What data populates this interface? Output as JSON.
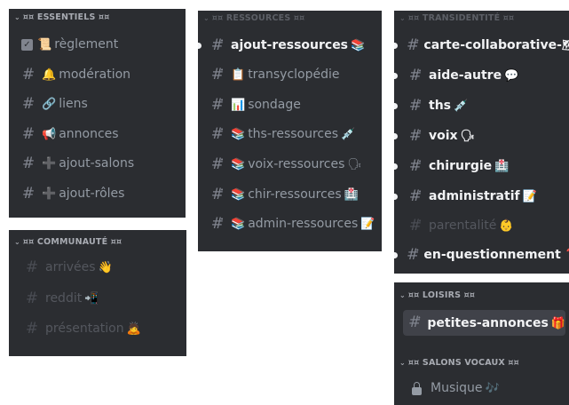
{
  "panels": {
    "essentiels": {
      "title": "¤¤ ESSENTIELS ¤¤",
      "channels": [
        {
          "label": "règlement",
          "emoji": "📜"
        },
        {
          "label": "modération",
          "emoji": "🔔"
        },
        {
          "label": "liens",
          "emoji": "🔗"
        },
        {
          "label": "annonces",
          "emoji": "📢"
        },
        {
          "label": "ajout-salons",
          "emoji": "➕"
        },
        {
          "label": "ajout-rôles",
          "emoji": "➕"
        }
      ]
    },
    "communaute": {
      "title": "¤¤ COMMUNAUTÉ ¤¤",
      "channels": [
        {
          "label": "arrivées",
          "emoji": "👋"
        },
        {
          "label": "reddit",
          "emoji": "📲"
        },
        {
          "label": "présentation",
          "emoji": "🙇"
        }
      ]
    },
    "ressources": {
      "title": "¤¤ RESSOURCES ¤¤",
      "channels": [
        {
          "label": "ajout-ressources",
          "emoji": "📚"
        },
        {
          "label": "transyclopédie",
          "emoji": "📋"
        },
        {
          "label": "sondage",
          "emoji": "📊"
        },
        {
          "label": "ths-ressources",
          "emoji": "💉"
        },
        {
          "label": "voix-ressources",
          "emoji": "🗣"
        },
        {
          "label": "chir-ressources",
          "emoji": "🏥"
        },
        {
          "label": "admin-ressources",
          "emoji": "📝"
        }
      ]
    },
    "transidentite": {
      "title": "¤¤ TRANSIDENTITÉ ¤¤",
      "channels": [
        {
          "label": "carte-collaborative-",
          "emoji": "🗺"
        },
        {
          "label": "aide-autre",
          "emoji": "💬"
        },
        {
          "label": "ths",
          "emoji": "💉"
        },
        {
          "label": "voix",
          "emoji": "🗣"
        },
        {
          "label": "chirurgie",
          "emoji": "🏥"
        },
        {
          "label": "administratif",
          "emoji": "📝"
        },
        {
          "label": "parentalité",
          "emoji": "👶"
        },
        {
          "label": "en-questionnement",
          "emoji": "❓"
        }
      ]
    },
    "loisirs": {
      "title": "¤¤ LOISIRS ¤¤",
      "channels": [
        {
          "label": "petites-annonces",
          "emoji": "🎁"
        }
      ]
    },
    "vocaux": {
      "title": "¤¤ SALONS VOCAUX ¤¤",
      "channels": [
        {
          "label": "Musique",
          "emoji": "🎶"
        }
      ]
    }
  }
}
